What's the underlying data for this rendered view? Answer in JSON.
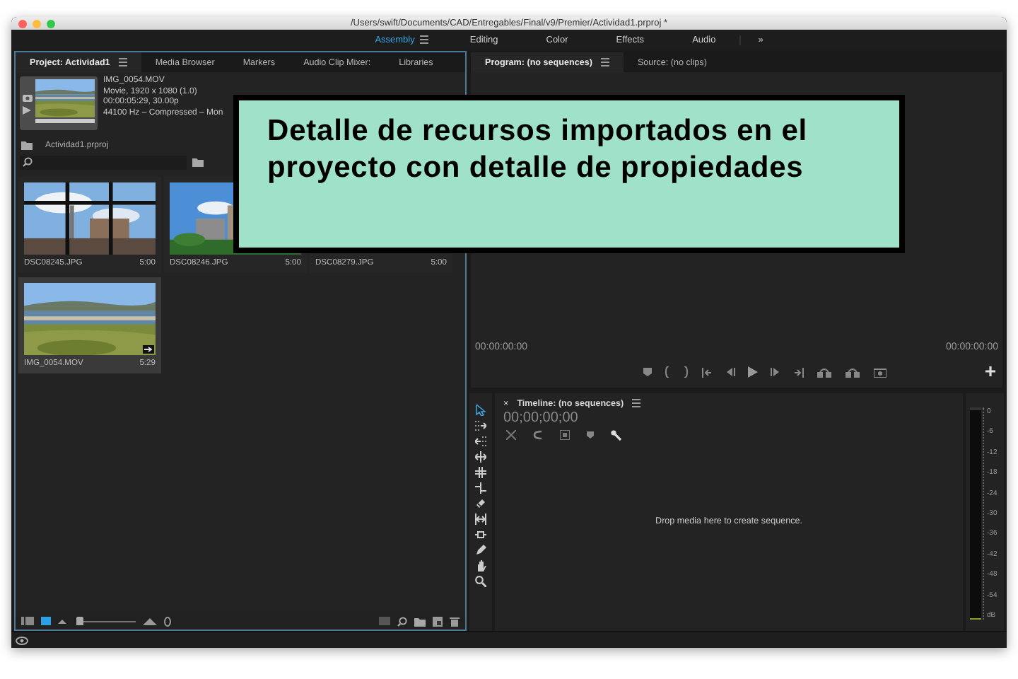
{
  "window": {
    "title": "/Users/swift/Documents/CAD/Entregables/Final/v9/Premier/Actividad1.prproj *"
  },
  "workspaces": [
    {
      "label": "Assembly",
      "selected": true
    },
    {
      "label": "Editing",
      "selected": false
    },
    {
      "label": "Color",
      "selected": false
    },
    {
      "label": "Effects",
      "selected": false
    },
    {
      "label": "Audio",
      "selected": false
    }
  ],
  "workspace_more": "»",
  "project_panel": {
    "tabs": [
      {
        "label": "Project: Actividad1",
        "selected": true
      },
      {
        "label": "Media Browser",
        "selected": false
      },
      {
        "label": "Markers",
        "selected": false
      },
      {
        "label": "Audio Clip Mixer:",
        "selected": false
      },
      {
        "label": "Libraries",
        "selected": false
      }
    ],
    "preview": {
      "name": "IMG_0054.MOV",
      "details": [
        "Movie, 1920 x 1080 (1.0)",
        "00:00:05:29, 30.00p",
        "44100 Hz – Compressed – Mon"
      ]
    },
    "project_file": "Actividad1.prproj",
    "zoom_slider": {
      "level": 0
    },
    "items": [
      {
        "name": "DSC08245.JPG",
        "duration": "5:00",
        "selected": false,
        "covered": false
      },
      {
        "name": "DSC08246.JPG",
        "duration": "5:00",
        "selected": false,
        "covered": false
      },
      {
        "name": "DSC08279.JPG",
        "duration": "5:00",
        "selected": false,
        "covered": true
      },
      {
        "name": "IMG_0054.MOV",
        "duration": "5:29",
        "kind": "video",
        "selected": true,
        "covered": false
      }
    ]
  },
  "program_monitor": {
    "tabs": [
      {
        "label": "Program: (no sequences)",
        "selected": true
      },
      {
        "label": "Source: (no clips)",
        "selected": false
      }
    ],
    "timecode_left": "00:00:00:00",
    "timecode_right": "00:00:00:00"
  },
  "timeline": {
    "close": "×",
    "title": "Timeline: (no sequences)",
    "timecode": "00;00;00;00",
    "message": "Drop media here to create sequence."
  },
  "audio_meter": {
    "scale": [
      "0",
      "-6",
      "-12",
      "-18",
      "-24",
      "-30",
      "-36",
      "-42",
      "-48",
      "-54",
      "dB"
    ]
  },
  "callout": {
    "text": "Detalle de recursos importados en el proyecto con detalle de propiedades"
  }
}
